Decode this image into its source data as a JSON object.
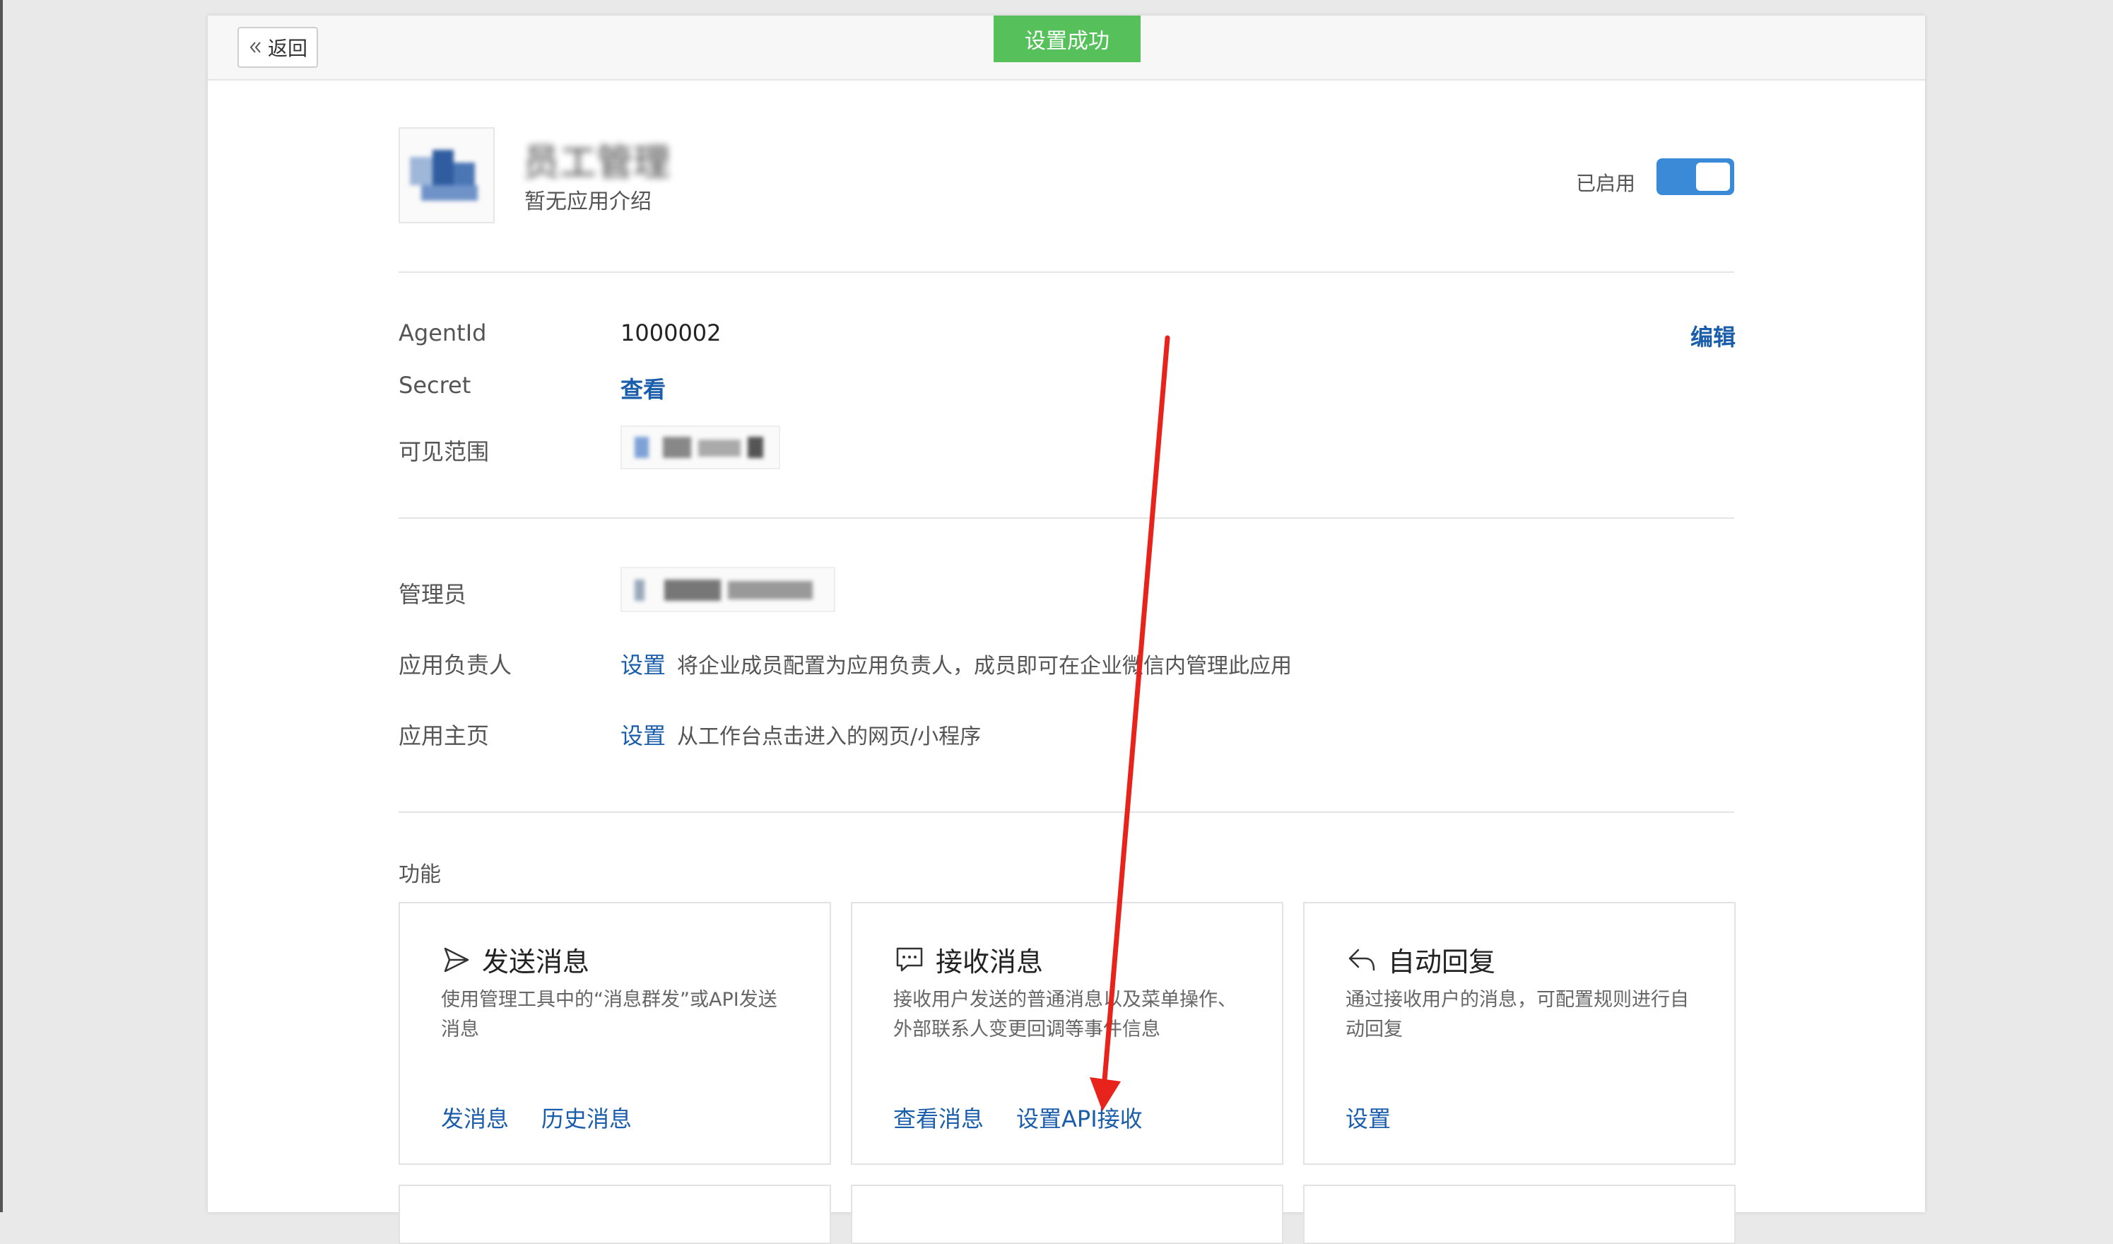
{
  "topbar": {
    "back_label": "返回",
    "toast": "设置成功"
  },
  "app": {
    "name": "员工管理",
    "description": "暂无应用介绍",
    "status_label": "已启用",
    "enabled": true
  },
  "details": {
    "agentid_label": "AgentId",
    "agentid_value": "1000002",
    "secret_label": "Secret",
    "secret_link": "查看",
    "visible_label": "可见范围",
    "edit_link": "编辑"
  },
  "management": {
    "admin_label": "管理员",
    "owner_label": "应用负责人",
    "owner_link": "设置",
    "owner_hint": "将企业成员配置为应用负责人，成员即可在企业微信内管理此应用",
    "homepage_label": "应用主页",
    "homepage_link": "设置",
    "homepage_hint": "从工作台点击进入的网页/小程序"
  },
  "features": {
    "title": "功能",
    "cards": [
      {
        "title": "发送消息",
        "icon": "send-icon",
        "desc": "使用管理工具中的“消息群发”或API发送消息",
        "links": [
          "发消息",
          "历史消息"
        ]
      },
      {
        "title": "接收消息",
        "icon": "chat-bubble-icon",
        "desc": "接收用户发送的普通消息以及菜单操作、外部联系人变更回调等事件信息",
        "links": [
          "查看消息",
          "设置API接收"
        ]
      },
      {
        "title": "自动回复",
        "icon": "reply-icon",
        "desc": "通过接收用户的消息，可配置规则进行自动回复",
        "links": [
          "设置"
        ]
      }
    ]
  },
  "colors": {
    "accent": "#1a5dab",
    "toast": "#56c15a",
    "toggle": "#3a8ad8",
    "annotation": "#e8231b"
  }
}
